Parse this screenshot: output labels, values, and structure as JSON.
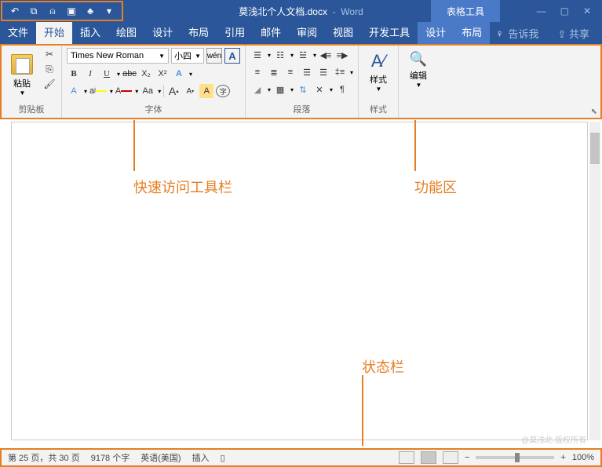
{
  "title": {
    "document": "莫浅北个人文档.docx",
    "separator": "-",
    "app": "Word"
  },
  "context_tab": "表格工具",
  "tabs": {
    "file": "文件",
    "home": "开始",
    "insert": "插入",
    "draw": "绘图",
    "design": "设计",
    "layout": "布局",
    "references": "引用",
    "mail": "邮件",
    "review": "审阅",
    "view": "视图",
    "dev": "开发工具",
    "ctx_design": "设计",
    "ctx_layout": "布局",
    "tell_me": "告诉我",
    "share": "共享"
  },
  "ribbon": {
    "clipboard": {
      "label": "剪贴板",
      "paste": "粘贴"
    },
    "font": {
      "label": "字体",
      "name": "Times New Roman",
      "size": "小四",
      "B": "B",
      "I": "I",
      "U": "U",
      "abc": "abc",
      "x2": "X₂",
      "X2": "X²",
      "wen": "wén",
      "A_frame": "A",
      "Aclear": "A",
      "Ahl": "aʲ",
      "Acolor": "A",
      "Aa": "Aa",
      "Aplus": "A",
      "Aminus": "A",
      "Acircle": "A"
    },
    "paragraph": {
      "label": "段落"
    },
    "styles": {
      "label": "样式",
      "button": "样式",
      "icon": "A"
    },
    "editing": {
      "button": "编辑"
    }
  },
  "annotations": {
    "qat": "快速访问工具栏",
    "ribbon": "功能区",
    "status": "状态栏"
  },
  "status": {
    "page": "第 25 页，共 30 页",
    "words": "9178 个字",
    "lang": "英语(美国)",
    "mode": "插入",
    "zoom": "100%"
  },
  "watermark": "@莫浅北 版权所有"
}
